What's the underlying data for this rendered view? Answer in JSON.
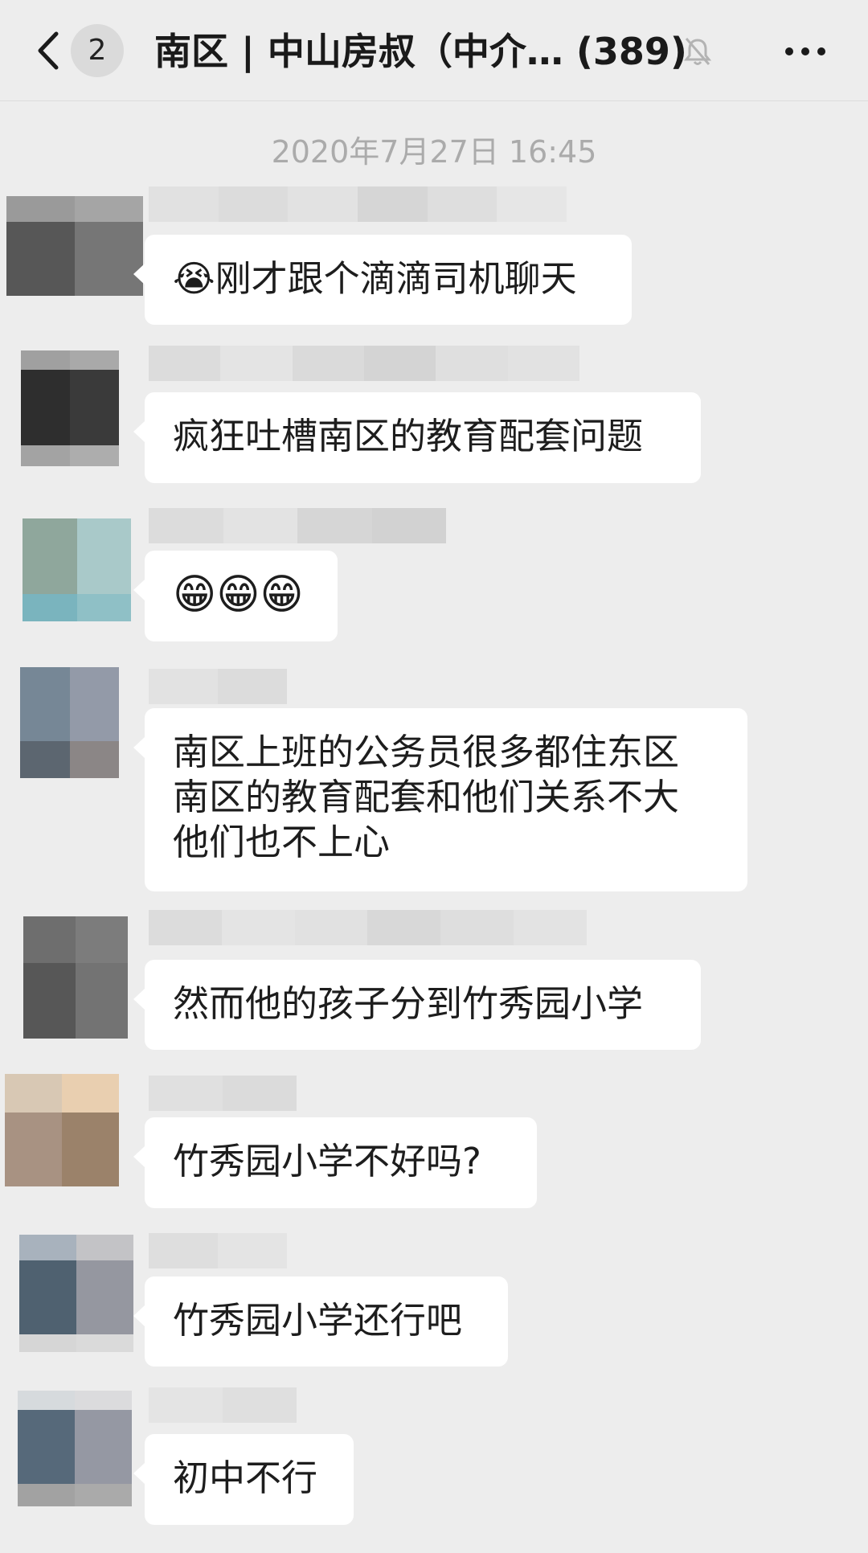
{
  "header": {
    "unread_count": "2",
    "title": "南区 | 中山房叔（中介… (389)"
  },
  "chat": {
    "timestamp": "2020年7月27日 16:45",
    "messages": [
      {
        "text": "😭刚才跟个滴滴司机聊天"
      },
      {
        "text": "疯狂吐槽南区的教育配套问题"
      },
      {
        "text": "😁😁😁"
      },
      {
        "lines": [
          "南区上班的公务员很多都住东区",
          "南区的教育配套和他们关系不大",
          "他们也不上心"
        ]
      },
      {
        "text": "然而他的孩子分到竹秀园小学"
      },
      {
        "text": "竹秀园小学不好吗?"
      },
      {
        "text": "竹秀园小学还行吧"
      },
      {
        "text": "初中不行"
      }
    ]
  },
  "icons": {
    "back": "chevron-left-icon",
    "mute": "bell-muted-icon",
    "more": "more-dots-icon"
  }
}
